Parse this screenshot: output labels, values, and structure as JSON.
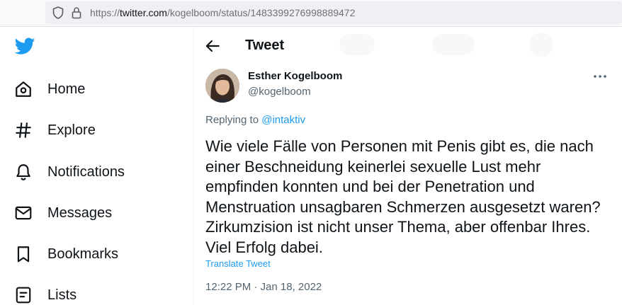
{
  "browser": {
    "url_prefix": "https://",
    "url_domain": "twitter.com",
    "url_path": "/kogelboom/status/1483399276998889472"
  },
  "sidebar": {
    "logo_icon": "twitter-bird-icon",
    "brand_color": "#1d9bf0",
    "items": [
      {
        "label": "Home",
        "icon": "home-icon"
      },
      {
        "label": "Explore",
        "icon": "hashtag-icon"
      },
      {
        "label": "Notifications",
        "icon": "bell-icon"
      },
      {
        "label": "Messages",
        "icon": "envelope-icon"
      },
      {
        "label": "Bookmarks",
        "icon": "bookmark-icon"
      },
      {
        "label": "Lists",
        "icon": "list-icon"
      }
    ]
  },
  "header": {
    "title": "Tweet",
    "back_icon": "back-arrow-icon"
  },
  "tweet": {
    "author_name": "Esther Kogelboom",
    "author_handle": "@kogelboom",
    "replying_prefix": "Replying to ",
    "replying_to": "@intaktiv",
    "text": "Wie viele Fälle von Personen mit Penis gibt es, die nach einer Beschneidung keinerlei sexuelle Lust mehr empfinden konnten und bei der Penetration und Menstruation unsagbaren Schmerzen ausgesetzt waren? Zirkumzision ist nicht unser Thema, aber offenbar Ihres. Viel Erfolg dabei.",
    "translate_label": "Translate Tweet",
    "timestamp": "12:22 PM · Jan 18, 2022",
    "more_icon": "more-options-icon"
  }
}
